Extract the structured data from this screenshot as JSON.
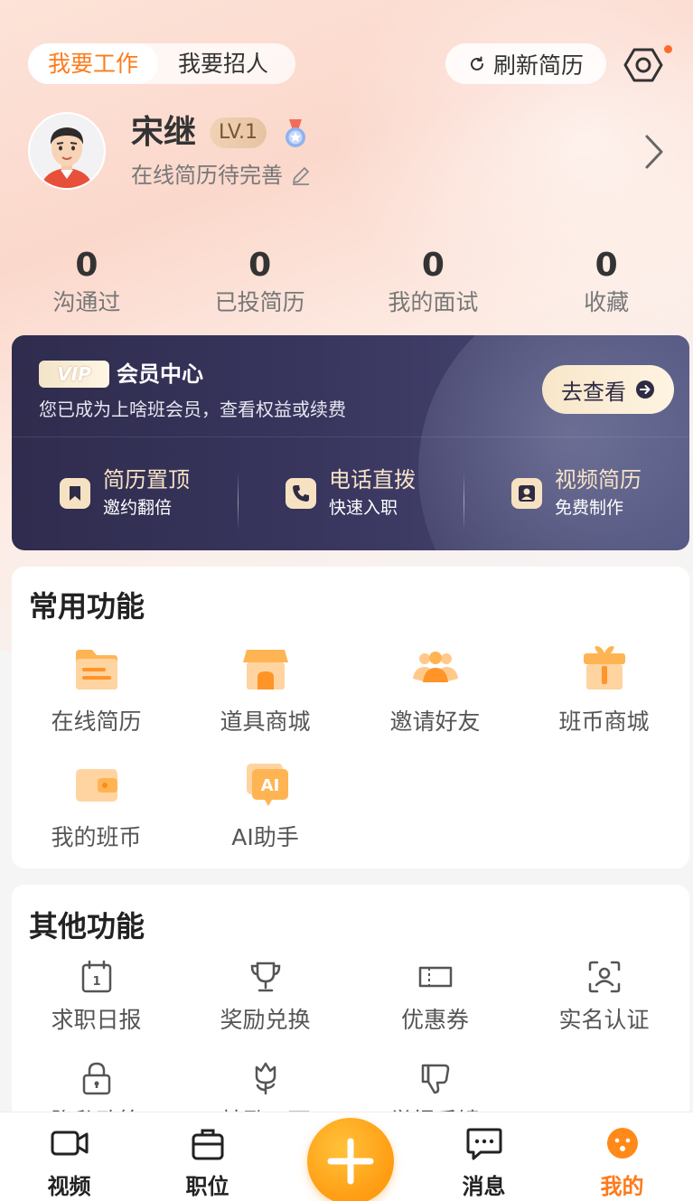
{
  "header": {
    "mode_tabs": [
      {
        "label": "我要工作",
        "active": true
      },
      {
        "label": "我要招人",
        "active": false
      }
    ],
    "refresh_label": "刷新简历",
    "settings_icon": "settings-hexagon-icon",
    "accent_color": "#ff7a1a"
  },
  "profile": {
    "name": "宋继",
    "level": "LV.1",
    "subtitle": "在线简历待完善"
  },
  "stats": [
    {
      "value": "0",
      "label": "沟通过"
    },
    {
      "value": "0",
      "label": "已投简历"
    },
    {
      "value": "0",
      "label": "我的面试"
    },
    {
      "value": "0",
      "label": "收藏"
    }
  ],
  "vip": {
    "badge": "VIP",
    "title": "会员中心",
    "description": "您已成为上啥班会员，查看权益或续费",
    "cta_label": "去查看",
    "benefits": [
      {
        "title": "简历置顶",
        "subtitle": "邀约翻倍",
        "icon": "bookmark-icon"
      },
      {
        "title": "电话直拨",
        "subtitle": "快速入职",
        "icon": "phone-icon"
      },
      {
        "title": "视频简历",
        "subtitle": "免费制作",
        "icon": "person-card-icon"
      }
    ]
  },
  "common_features": {
    "title": "常用功能",
    "items": [
      {
        "label": "在线简历",
        "icon": "folder-resume-icon"
      },
      {
        "label": "道具商城",
        "icon": "shop-icon"
      },
      {
        "label": "邀请好友",
        "icon": "friends-icon"
      },
      {
        "label": "班币商城",
        "icon": "gift-icon"
      },
      {
        "label": "我的班币",
        "icon": "wallet-icon"
      },
      {
        "label": "AI助手",
        "icon": "ai-assistant-icon"
      }
    ]
  },
  "other_features": {
    "title": "其他功能",
    "items": [
      {
        "label": "求职日报",
        "icon": "calendar-icon"
      },
      {
        "label": "奖励兑换",
        "icon": "trophy-icon"
      },
      {
        "label": "优惠券",
        "icon": "coupon-icon"
      },
      {
        "label": "实名认证",
        "icon": "face-scan-icon"
      },
      {
        "label": "隐私政策",
        "icon": "lock-icon"
      },
      {
        "label": "鼓励一下",
        "icon": "flower-icon"
      },
      {
        "label": "举报反馈",
        "icon": "thumbs-down-icon"
      }
    ]
  },
  "bottom_nav": [
    {
      "label": "视频",
      "icon": "video-icon",
      "active": false
    },
    {
      "label": "职位",
      "icon": "briefcase-icon",
      "active": false
    },
    {
      "label": "",
      "icon": "plus-icon",
      "active": false
    },
    {
      "label": "消息",
      "icon": "message-icon",
      "active": false
    },
    {
      "label": "我的",
      "icon": "me-face-icon",
      "active": true
    }
  ]
}
